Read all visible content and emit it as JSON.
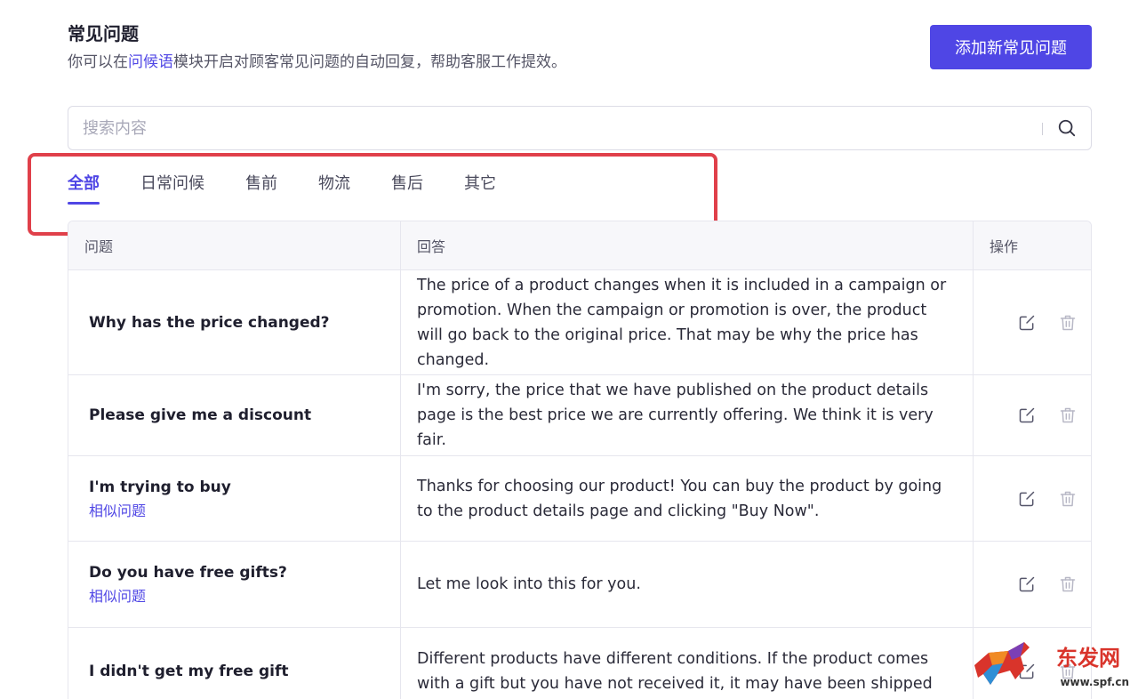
{
  "header": {
    "title": "常见问题",
    "subtitle_pre": "你可以在",
    "subtitle_link": "问候语",
    "subtitle_post": "模块开启对顾客常见问题的自动回复，帮助客服工作提效。",
    "add_button": "添加新常见问题"
  },
  "search": {
    "placeholder": "搜索内容"
  },
  "tabs": [
    "全部",
    "日常问候",
    "售前",
    "物流",
    "售后",
    "其它"
  ],
  "active_tab": "全部",
  "table": {
    "headers": {
      "question": "问题",
      "answer": "回答",
      "ops": "操作"
    },
    "rows": [
      {
        "question": "Why has the price changed?",
        "similar": "",
        "answer": "The price of a product changes when it is included in a campaign or promotion. When the campaign or promotion is over, the product will go back to the original price. That may be why the price has changed."
      },
      {
        "question": "Please give me a discount",
        "similar": "",
        "answer": "I'm sorry, the price that we have published on the product details page is the best price we are currently offering. We think it is very fair."
      },
      {
        "question": "I'm trying to buy",
        "similar": "相似问题",
        "answer": "Thanks for choosing our product! You can buy the product by going to the product details page and clicking \"Buy Now\"."
      },
      {
        "question": "Do you have free gifts?",
        "similar": "相似问题",
        "answer": "Let me look into this for you."
      },
      {
        "question": "I didn't get my free gift",
        "similar": "",
        "answer": "Different products have different conditions. If the product comes with a gift but you have not received it, it may have been shipped"
      }
    ]
  },
  "watermark": {
    "text": "东发网",
    "url": "www.spf.cn"
  },
  "colors": {
    "accent": "#4f46e5",
    "highlight": "#e0404a"
  }
}
